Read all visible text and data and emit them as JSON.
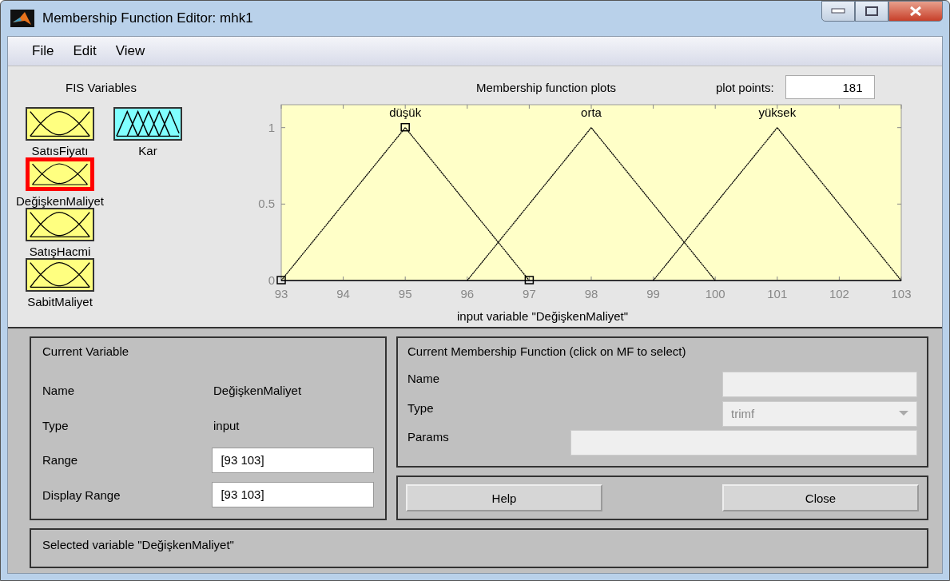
{
  "window": {
    "title": "Membership Function Editor: mhk1"
  },
  "menu": [
    "File",
    "Edit",
    "View"
  ],
  "fis_variables": {
    "title": "FIS Variables",
    "items": [
      {
        "label": "SatısFiyatı",
        "kind": "input",
        "selected": false
      },
      {
        "label": "Kar",
        "kind": "output",
        "selected": false
      },
      {
        "label": "DeğişkenMaliyet",
        "kind": "input",
        "selected": true
      },
      {
        "label": "SatışHacmi",
        "kind": "input",
        "selected": false
      },
      {
        "label": "SabitMaliyet",
        "kind": "input",
        "selected": false
      }
    ]
  },
  "plot": {
    "title": "Membership function plots",
    "plot_points_label": "plot points:",
    "plot_points": "181",
    "chart_data": {
      "type": "line",
      "xlabel": "input variable \"DeğişkenMaliyet\"",
      "x": [
        93,
        94,
        95,
        96,
        97,
        98,
        99,
        100,
        101,
        102,
        103
      ],
      "series": [
        {
          "name": "düşük",
          "color": "#000000",
          "line_style": "dotted",
          "values": [
            0,
            0.5,
            1,
            0.5,
            0,
            null,
            null,
            null,
            null,
            null,
            null
          ]
        },
        {
          "name": "orta",
          "color": "#000000",
          "line_style": "dotted",
          "values": [
            null,
            null,
            null,
            0,
            0.5,
            1,
            0.5,
            0,
            null,
            null,
            null
          ]
        },
        {
          "name": "yüksek",
          "color": "#000000",
          "line_style": "dotted",
          "values": [
            null,
            null,
            null,
            null,
            null,
            null,
            0,
            0.5,
            1,
            0.5,
            0
          ]
        }
      ],
      "xlim": [
        93,
        103
      ],
      "ylim": [
        0,
        1.15
      ],
      "xticks": [
        93,
        94,
        95,
        96,
        97,
        98,
        99,
        100,
        101,
        102,
        103
      ],
      "yticks": [
        0,
        0.5,
        1
      ]
    },
    "curves": [
      {
        "selected": true
      },
      {
        "selected": false
      },
      {
        "selected": false
      }
    ]
  },
  "current_variable": {
    "title": "Current Variable",
    "fields": [
      {
        "label": "Name",
        "value": "DeğişkenMaliyet",
        "kind": "text"
      },
      {
        "label": "Type",
        "value": "input",
        "kind": "text"
      },
      {
        "label": "Range",
        "value": "[93 103]",
        "kind": "input"
      },
      {
        "label": "Display Range",
        "value": "[93 103]",
        "kind": "input"
      }
    ]
  },
  "current_mf": {
    "title": "Current Membership Function (click on MF to select)",
    "name_label": "Name",
    "type_label": "Type",
    "type_value": "trimf",
    "params_label": "Params",
    "disabled": true
  },
  "buttons": [
    "Help",
    "Close"
  ],
  "status": "Selected variable \"DeğişkenMaliyet\""
}
